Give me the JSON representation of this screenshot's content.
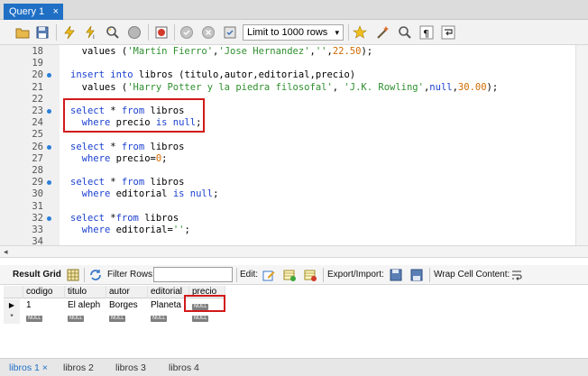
{
  "tabs": [
    {
      "label": "Query 1",
      "close": "×"
    }
  ],
  "toolbar": {
    "limit": {
      "selected": "Limit to 1000 rows",
      "arrow": "▾"
    }
  },
  "editor": {
    "lines": [
      {
        "n": "18",
        "dot": false,
        "segs": [
          [
            "",
            "  values ("
          ],
          [
            "str",
            "'Martín Fierro'"
          ],
          [
            "",
            ","
          ],
          [
            "str",
            "'Jose Hernandez'"
          ],
          [
            "",
            ","
          ],
          [
            "str",
            "''"
          ],
          [
            "",
            ","
          ],
          [
            "num",
            "22.50"
          ],
          [
            "",
            ");"
          ]
        ]
      },
      {
        "n": "19",
        "dot": false,
        "segs": []
      },
      {
        "n": "20",
        "dot": true,
        "segs": [
          [
            "kw",
            "insert into"
          ],
          [
            "",
            " libros (titulo,autor,editorial,precio)"
          ]
        ]
      },
      {
        "n": "21",
        "dot": false,
        "segs": [
          [
            "",
            "  values ("
          ],
          [
            "str",
            "'Harry Potter y la piedra filosofal'"
          ],
          [
            "",
            ", "
          ],
          [
            "str",
            "'J.K. Rowling'"
          ],
          [
            "",
            ","
          ],
          [
            "kw",
            "null"
          ],
          [
            "",
            ","
          ],
          [
            "num",
            "30.00"
          ],
          [
            "",
            ");"
          ]
        ]
      },
      {
        "n": "22",
        "dot": false,
        "segs": []
      },
      {
        "n": "23",
        "dot": true,
        "segs": [
          [
            "kw",
            "select"
          ],
          [
            "",
            " * "
          ],
          [
            "kw",
            "from"
          ],
          [
            "",
            " libros"
          ]
        ]
      },
      {
        "n": "24",
        "dot": false,
        "segs": [
          [
            "",
            "  "
          ],
          [
            "kw",
            "where"
          ],
          [
            "",
            " precio "
          ],
          [
            "kw",
            "is null"
          ],
          [
            "",
            ";"
          ]
        ]
      },
      {
        "n": "25",
        "dot": false,
        "segs": []
      },
      {
        "n": "26",
        "dot": true,
        "segs": [
          [
            "kw",
            "select"
          ],
          [
            "",
            " * "
          ],
          [
            "kw",
            "from"
          ],
          [
            "",
            " libros"
          ]
        ]
      },
      {
        "n": "27",
        "dot": false,
        "segs": [
          [
            "",
            "  "
          ],
          [
            "kw",
            "where"
          ],
          [
            "",
            " precio="
          ],
          [
            "num",
            "0"
          ],
          [
            "",
            ";"
          ]
        ]
      },
      {
        "n": "28",
        "dot": false,
        "segs": []
      },
      {
        "n": "29",
        "dot": true,
        "segs": [
          [
            "kw",
            "select"
          ],
          [
            "",
            " * "
          ],
          [
            "kw",
            "from"
          ],
          [
            "",
            " libros"
          ]
        ]
      },
      {
        "n": "30",
        "dot": false,
        "segs": [
          [
            "",
            "  "
          ],
          [
            "kw",
            "where"
          ],
          [
            "",
            " editorial "
          ],
          [
            "kw",
            "is null"
          ],
          [
            "",
            ";"
          ]
        ]
      },
      {
        "n": "31",
        "dot": false,
        "segs": []
      },
      {
        "n": "32",
        "dot": true,
        "segs": [
          [
            "kw",
            "select"
          ],
          [
            "",
            " *"
          ],
          [
            "kw",
            "from"
          ],
          [
            "",
            " libros"
          ]
        ]
      },
      {
        "n": "33",
        "dot": false,
        "segs": [
          [
            "",
            "  "
          ],
          [
            "kw",
            "where"
          ],
          [
            "",
            " editorial="
          ],
          [
            "str",
            "''"
          ],
          [
            "",
            ";"
          ]
        ]
      },
      {
        "n": "34",
        "dot": false,
        "segs": []
      }
    ]
  },
  "hscroll_arrow": "◂",
  "result_toolbar": {
    "result_grid": "Result Grid",
    "filter_rows": "Filter Rows:",
    "edit": "Edit:",
    "export_import": "Export/Import:",
    "wrap": "Wrap Cell Content:"
  },
  "grid": {
    "columns": [
      "codigo",
      "titulo",
      "autor",
      "editorial",
      "precio"
    ],
    "rows": [
      {
        "marker": "▶",
        "cells": [
          "1",
          "El aleph",
          "Borges",
          "Planeta",
          "NULL"
        ]
      },
      {
        "marker": "*",
        "cells": [
          "NULL",
          "NULL",
          "NULL",
          "NULL",
          "NULL"
        ]
      }
    ]
  },
  "bottom_tabs": [
    "libros 1 ×",
    "libros 2",
    "libros 3",
    "libros 4"
  ],
  "colors": {
    "accent": "#1f6fc5",
    "highlight": "#d21a1a",
    "keyword": "#1a3fd0",
    "string": "#2f8f2f",
    "number": "#d06a00"
  }
}
